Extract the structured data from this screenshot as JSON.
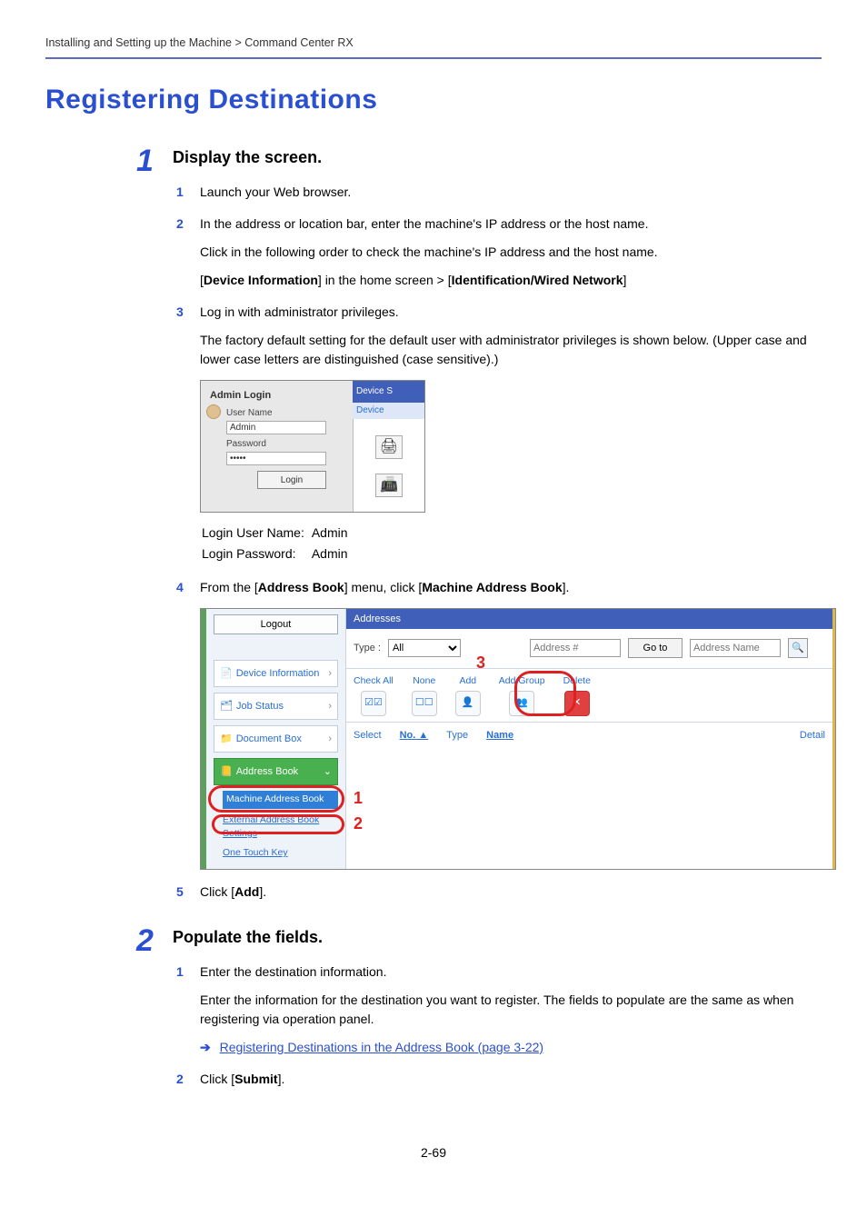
{
  "breadcrumb": "Installing and Setting up the Machine > Command Center RX",
  "h1": "Registering Destinations",
  "section1": {
    "num": "1",
    "title": "Display the screen.",
    "steps": {
      "s1": {
        "num": "1",
        "text": "Launch your Web browser."
      },
      "s2": {
        "num": "2",
        "text": "In the address or location bar, enter the machine's IP address or the host name.",
        "sub1": "Click in the following order to check the machine's IP address and the host name.",
        "sub2_pre": "[",
        "sub2_b1": "Device Information",
        "sub2_mid": "] in the home screen > [",
        "sub2_b2": "Identification/Wired Network",
        "sub2_post": "]"
      },
      "s3": {
        "num": "3",
        "text": "Log in with administrator privileges.",
        "sub": "The factory default setting for the default user with administrator privileges is shown below. (Upper case and lower case letters are distinguished (case sensitive).)",
        "login_shot": {
          "admin_login": "Admin Login",
          "user_name_label": "User Name",
          "user_name_value": "Admin",
          "password_label": "Password",
          "password_value": "•••••",
          "login_btn": "Login",
          "device_s": "Device S",
          "device": "Device"
        },
        "cred": {
          "user_lbl": "Login User Name:",
          "user_val": "Admin",
          "pass_lbl": "Login Password:",
          "pass_val": "Admin"
        }
      },
      "s4": {
        "num": "4",
        "pre": "From the [",
        "b1": "Address Book",
        "mid": "] menu, click [",
        "b2": "Machine Address Book",
        "post": "].",
        "ab_shot": {
          "logout": "Logout",
          "nav_device_info": "Device Information",
          "nav_job_status": "Job Status",
          "nav_doc_box": "Document Box",
          "nav_address_book": "Address Book",
          "sub_machine": "Machine Address Book",
          "sub_external": "External Address Book Settings",
          "sub_onetouch": "One Touch Key",
          "main_head": "Addresses",
          "type_lbl": "Type :",
          "type_sel": "All",
          "addr_num_ph": "Address #",
          "go_to": "Go to",
          "addr_name_ph": "Address Name",
          "tool_checkall": "Check All",
          "tool_none": "None",
          "tool_add": "Add",
          "tool_addgroup": "Add Group",
          "tool_delete": "Delete",
          "col_select": "Select",
          "col_no": "No.",
          "col_type": "Type",
          "col_name": "Name",
          "col_detail": "Detail",
          "callout1": "1",
          "callout2": "2",
          "callout3": "3"
        }
      },
      "s5": {
        "num": "5",
        "pre": "Click [",
        "b": "Add",
        "post": "]."
      }
    }
  },
  "section2": {
    "num": "2",
    "title": "Populate the fields.",
    "steps": {
      "s1": {
        "num": "1",
        "text": "Enter the destination information.",
        "sub": "Enter the information for the destination you want to register. The fields to populate are the same as when registering via operation panel.",
        "ref": "Registering Destinations in the Address Book (page 3-22)"
      },
      "s2": {
        "num": "2",
        "pre": "Click [",
        "b": "Submit",
        "post": "]."
      }
    }
  },
  "page_number": "2-69"
}
